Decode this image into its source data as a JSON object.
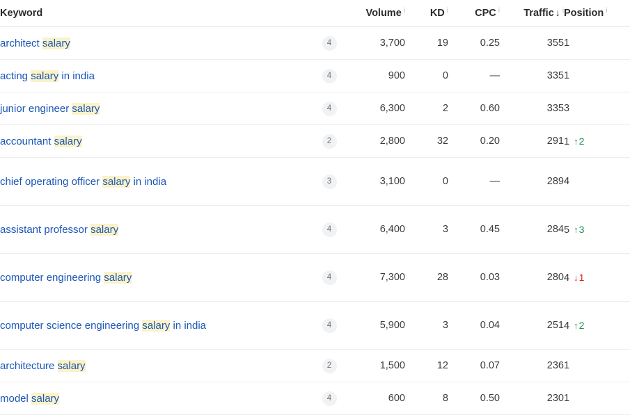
{
  "table": {
    "columns": [
      {
        "key": "keyword",
        "label": "Keyword",
        "info_icon": "info-icon",
        "has_info": false,
        "sorted": false
      },
      {
        "key": "volume",
        "label": "Volume",
        "info_icon": "info-icon",
        "has_info": true,
        "sorted": false
      },
      {
        "key": "kd",
        "label": "KD",
        "info_icon": "info-icon",
        "has_info": true,
        "sorted": false
      },
      {
        "key": "cpc",
        "label": "CPC",
        "info_icon": "info-icon",
        "has_info": true,
        "sorted": false
      },
      {
        "key": "traffic",
        "label": "Traffic",
        "info_icon": "info-icon",
        "has_info": true,
        "sorted": true,
        "sort_arrow": "↓",
        "sort_direction": "descending"
      },
      {
        "key": "position",
        "label": "Position",
        "info_icon": "info-icon",
        "has_info": true,
        "sorted": false
      }
    ],
    "highlight_term": "salary",
    "rows": [
      {
        "keyword_parts": [
          {
            "text": "architect ",
            "highlight": false
          },
          {
            "text": "salary",
            "highlight": true
          }
        ],
        "badge": "4",
        "volume": "3,700",
        "kd": "19",
        "cpc": "0.25",
        "traffic": "355",
        "position": "1",
        "change": null,
        "change_dir": null,
        "tall": false
      },
      {
        "keyword_parts": [
          {
            "text": "acting ",
            "highlight": false
          },
          {
            "text": "salary",
            "highlight": true
          },
          {
            "text": " in india",
            "highlight": false
          }
        ],
        "badge": "4",
        "volume": "900",
        "kd": "0",
        "cpc": "—",
        "traffic": "335",
        "position": "1",
        "change": null,
        "change_dir": null,
        "tall": false
      },
      {
        "keyword_parts": [
          {
            "text": "junior engineer ",
            "highlight": false
          },
          {
            "text": "salary",
            "highlight": true
          }
        ],
        "badge": "4",
        "volume": "6,300",
        "kd": "2",
        "cpc": "0.60",
        "traffic": "335",
        "position": "3",
        "change": null,
        "change_dir": null,
        "tall": false
      },
      {
        "keyword_parts": [
          {
            "text": "accountant ",
            "highlight": false
          },
          {
            "text": "salary",
            "highlight": true
          }
        ],
        "badge": "2",
        "volume": "2,800",
        "kd": "32",
        "cpc": "0.20",
        "traffic": "291",
        "position": "1",
        "change": "2",
        "change_dir": "up",
        "tall": false
      },
      {
        "keyword_parts": [
          {
            "text": "chief operating officer ",
            "highlight": false
          },
          {
            "text": "salary",
            "highlight": true
          },
          {
            "text": " in india",
            "highlight": false
          }
        ],
        "badge": "3",
        "volume": "3,100",
        "kd": "0",
        "cpc": "—",
        "traffic": "289",
        "position": "4",
        "change": null,
        "change_dir": null,
        "tall": true
      },
      {
        "keyword_parts": [
          {
            "text": "assistant professor ",
            "highlight": false
          },
          {
            "text": "salary",
            "highlight": true
          }
        ],
        "badge": "4",
        "volume": "6,400",
        "kd": "3",
        "cpc": "0.45",
        "traffic": "284",
        "position": "5",
        "change": "3",
        "change_dir": "up",
        "tall": true
      },
      {
        "keyword_parts": [
          {
            "text": "computer engineering ",
            "highlight": false
          },
          {
            "text": "salary",
            "highlight": true
          }
        ],
        "badge": "4",
        "volume": "7,300",
        "kd": "28",
        "cpc": "0.03",
        "traffic": "280",
        "position": "4",
        "change": "1",
        "change_dir": "down",
        "tall": true
      },
      {
        "keyword_parts": [
          {
            "text": "computer science engineering ",
            "highlight": false
          },
          {
            "text": "salary",
            "highlight": true
          },
          {
            "text": " in india",
            "highlight": false
          }
        ],
        "badge": "4",
        "volume": "5,900",
        "kd": "3",
        "cpc": "0.04",
        "traffic": "251",
        "position": "4",
        "change": "2",
        "change_dir": "up",
        "tall": true
      },
      {
        "keyword_parts": [
          {
            "text": "architecture ",
            "highlight": false
          },
          {
            "text": "salary",
            "highlight": true
          }
        ],
        "badge": "2",
        "volume": "1,500",
        "kd": "12",
        "cpc": "0.07",
        "traffic": "236",
        "position": "1",
        "change": null,
        "change_dir": null,
        "tall": false
      },
      {
        "keyword_parts": [
          {
            "text": "model ",
            "highlight": false
          },
          {
            "text": "salary",
            "highlight": true
          }
        ],
        "badge": "4",
        "volume": "600",
        "kd": "8",
        "cpc": "0.50",
        "traffic": "230",
        "position": "1",
        "change": null,
        "change_dir": null,
        "tall": false
      }
    ]
  },
  "icons": {
    "info": "i",
    "arrow_up": "↑",
    "arrow_down": "↓",
    "sort_desc": "↓"
  },
  "colors": {
    "link": "#1a56b8",
    "highlight": "#fcf2c7",
    "increase": "#17914e",
    "decrease": "#e02020",
    "text": "#3c3c3c",
    "badge_bg": "#f1f2f4",
    "border": "#ededed"
  }
}
